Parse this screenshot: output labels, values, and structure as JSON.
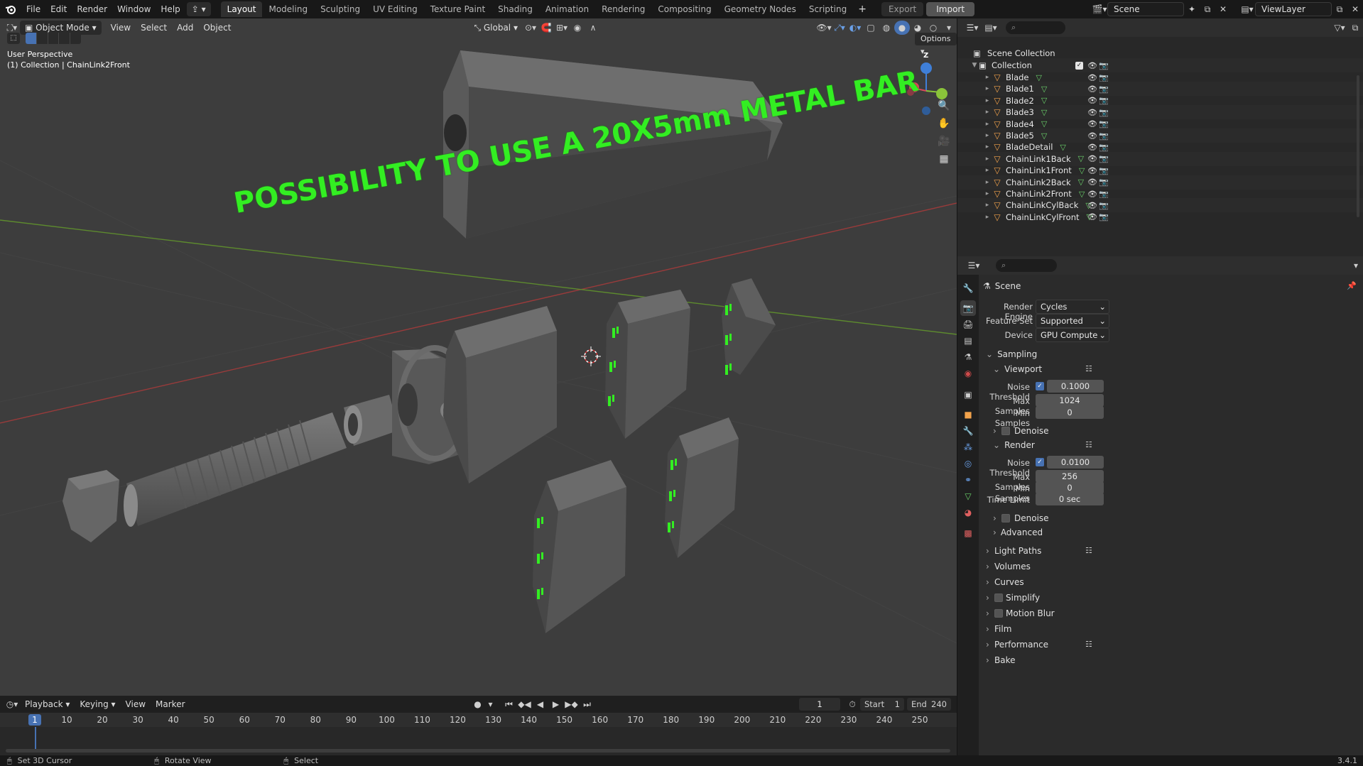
{
  "topbar": {
    "menus": [
      "File",
      "Edit",
      "Render",
      "Window",
      "Help"
    ],
    "workspaces": [
      "Layout",
      "Modeling",
      "Sculpting",
      "UV Editing",
      "Texture Paint",
      "Shading",
      "Animation",
      "Rendering",
      "Compositing",
      "Geometry Nodes",
      "Scripting"
    ],
    "active_workspace": "Layout",
    "add_workspace": "+",
    "export_label": "Export",
    "import_label": "Import",
    "scene_name": "Scene",
    "view_layer": "ViewLayer"
  },
  "viewport": {
    "mode": "Object Mode",
    "menus": [
      "View",
      "Select",
      "Add",
      "Object"
    ],
    "orientation": "Global",
    "options_label": "Options",
    "perspective_label": "User Perspective",
    "collection_info": "(1) Collection | ChainLink2Front",
    "overlay_caption": "POSSIBILITY TO USE A 20X5mm METAL BAR",
    "gizmo_z": "Z",
    "colors": {
      "background": "#3d3d3d",
      "caption": "#33ee22",
      "axis_red": "#9a3b3b",
      "axis_green": "#5d8a2e",
      "metal": "#5b5b5b"
    }
  },
  "timeline": {
    "menus": [
      "Playback",
      "Keying",
      "View",
      "Marker"
    ],
    "current_frame": "1",
    "start_label": "Start",
    "start_value": "1",
    "end_label": "End",
    "end_value": "240",
    "ruler_ticks": [
      "1",
      "10",
      "20",
      "30",
      "40",
      "50",
      "60",
      "70",
      "80",
      "90",
      "100",
      "110",
      "120",
      "130",
      "140",
      "150",
      "160",
      "170",
      "180",
      "190",
      "200",
      "210",
      "220",
      "230",
      "240",
      "250"
    ]
  },
  "statusbar": {
    "hints": [
      "Set 3D Cursor",
      "Rotate View",
      "Select"
    ],
    "version": "3.4.1"
  },
  "outliner": {
    "root": "Scene Collection",
    "collection": "Collection",
    "objects": [
      "Blade",
      "Blade1",
      "Blade2",
      "Blade3",
      "Blade4",
      "Blade5",
      "BladeDetail",
      "ChainLink1Back",
      "ChainLink1Front",
      "ChainLink2Back",
      "ChainLink2Front",
      "ChainLinkCylBack",
      "ChainLinkCylFront"
    ]
  },
  "properties": {
    "context": "Scene",
    "render_engine_label": "Render Engine",
    "render_engine": "Cycles",
    "feature_set_label": "Feature Set",
    "feature_set": "Supported",
    "device_label": "Device",
    "device": "GPU Compute",
    "sampling": "Sampling",
    "viewport": "Viewport",
    "render": "Render",
    "noise_threshold_label": "Noise Threshold",
    "max_samples_label": "Max Samples",
    "min_samples_label": "Min Samples",
    "time_limit_label": "Time Limit",
    "viewport_noise_threshold": "0.1000",
    "viewport_max_samples": "1024",
    "viewport_min_samples": "0",
    "render_noise_threshold": "0.0100",
    "render_max_samples": "256",
    "render_min_samples": "0",
    "render_time_limit": "0 sec",
    "denoise": "Denoise",
    "advanced": "Advanced",
    "sections": [
      "Light Paths",
      "Volumes",
      "Curves",
      "Simplify",
      "Motion Blur",
      "Film",
      "Performance",
      "Bake"
    ]
  }
}
